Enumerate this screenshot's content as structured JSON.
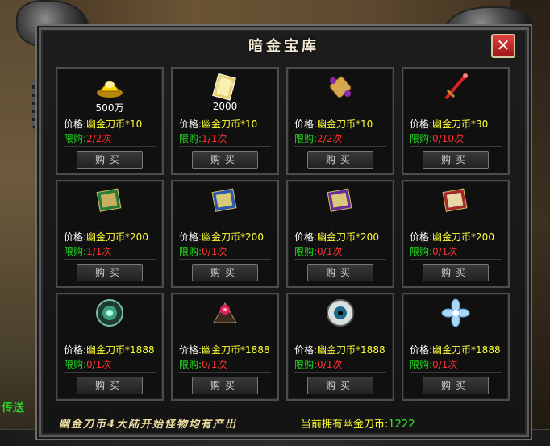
{
  "window": {
    "title": "暗金宝库",
    "close_label": "✕"
  },
  "background": {
    "side_text": "传送"
  },
  "items": [
    {
      "icon": "gold-ingot-icon",
      "qty": "500万",
      "price_label": "价格:",
      "price": "幽金刀币*10",
      "limit_label": "限购:",
      "limit": "2/2次",
      "buy_label": "购买"
    },
    {
      "icon": "gold-note-icon",
      "qty": "2000",
      "price_label": "价格:",
      "price": "幽金刀币*10",
      "limit_label": "限购:",
      "limit": "1/1次",
      "buy_label": "购买"
    },
    {
      "icon": "scroll-icon",
      "qty": "",
      "price_label": "价格:",
      "price": "幽金刀币*10",
      "limit_label": "限购:",
      "limit": "2/2次",
      "buy_label": "购买"
    },
    {
      "icon": "red-sword-icon",
      "qty": "",
      "price_label": "价格:",
      "price": "幽金刀币*30",
      "limit_label": "限购:",
      "limit": "0/10次",
      "buy_label": "购买"
    },
    {
      "icon": "green-book-icon",
      "qty": "",
      "price_label": "价格:",
      "price": "幽金刀币*200",
      "limit_label": "限购:",
      "limit": "1/1次",
      "buy_label": "购买"
    },
    {
      "icon": "blue-book-icon",
      "qty": "",
      "price_label": "价格:",
      "price": "幽金刀币*200",
      "limit_label": "限购:",
      "limit": "0/1次",
      "buy_label": "购买"
    },
    {
      "icon": "purple-book-icon",
      "qty": "",
      "price_label": "价格:",
      "price": "幽金刀币*200",
      "limit_label": "限购:",
      "limit": "0/1次",
      "buy_label": "购买"
    },
    {
      "icon": "red-book-icon",
      "qty": "",
      "price_label": "价格:",
      "price": "幽金刀币*200",
      "limit_label": "限购:",
      "limit": "0/1次",
      "buy_label": "购买"
    },
    {
      "icon": "green-shield-icon",
      "qty": "",
      "price_label": "价格:",
      "price": "幽金刀币*1888",
      "limit_label": "限购:",
      "limit": "0/1次",
      "buy_label": "购买"
    },
    {
      "icon": "red-jewel-icon",
      "qty": "",
      "price_label": "价格:",
      "price": "幽金刀币*1888",
      "limit_label": "限购:",
      "limit": "0/1次",
      "buy_label": "购买"
    },
    {
      "icon": "eye-orb-icon",
      "qty": "",
      "price_label": "价格:",
      "price": "幽金刀币*1888",
      "limit_label": "限购:",
      "limit": "0/1次",
      "buy_label": "购买"
    },
    {
      "icon": "blue-flower-icon",
      "qty": "",
      "price_label": "价格:",
      "price": "幽金刀币*1888",
      "limit_label": "限购:",
      "limit": "0/1次",
      "buy_label": "购买"
    }
  ],
  "footer": {
    "hint": "幽金刀币4大陆开始怪物均有产出",
    "balance_label": "当前拥有幽金刀币:",
    "balance_value": "1222"
  },
  "colors": {
    "price": "#ffff33",
    "limit_label": "#22dd22",
    "limit_value": "#ff3030",
    "balance": "#33ee33"
  }
}
